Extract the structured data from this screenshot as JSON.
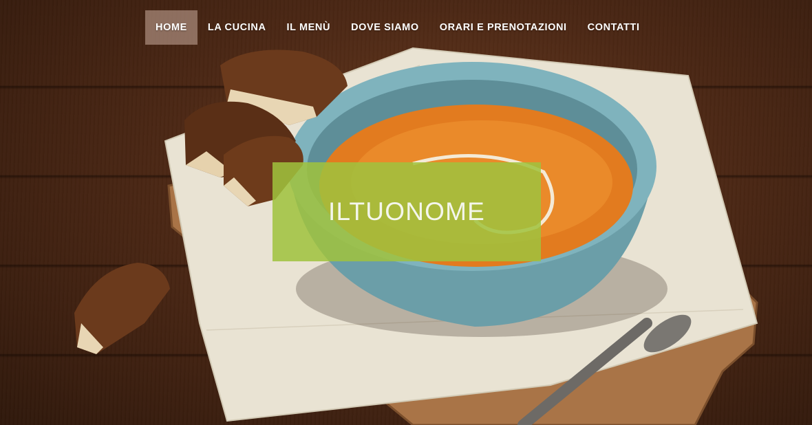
{
  "nav": {
    "items": [
      {
        "label": "HOME",
        "active": true
      },
      {
        "label": "LA CUCINA",
        "active": false
      },
      {
        "label": "IL MENÙ",
        "active": false
      },
      {
        "label": "DOVE SIAMO",
        "active": false
      },
      {
        "label": "ORARI E PRENOTAZIONI",
        "active": false
      },
      {
        "label": "CONTATTI",
        "active": false
      }
    ]
  },
  "hero": {
    "title": "ILTUONOME",
    "image": "soup-bowl-with-bread-on-wooden-table",
    "title_box_color": "#a0c23e"
  },
  "colors": {
    "nav_active_bg": "#aa8c7d",
    "wood_dark": "#2e170a",
    "soup": "#e07a1f",
    "bowl": "#6fa2ad",
    "linen": "#ece6d6"
  }
}
